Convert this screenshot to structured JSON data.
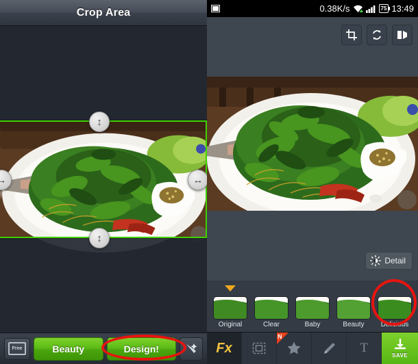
{
  "left": {
    "title": "Crop Area",
    "handles": [
      {
        "name": "crop-handle-top",
        "glyph": "↕"
      },
      {
        "name": "crop-handle-bottom",
        "glyph": "↕"
      },
      {
        "name": "crop-handle-left",
        "glyph": "↔"
      },
      {
        "name": "crop-handle-right",
        "glyph": "↔"
      }
    ],
    "toolbar": {
      "free_label": "Free",
      "beauty_label": "Beauty",
      "design_label": "Design!",
      "wand_icon": "magic-wand-icon"
    },
    "annotation": "red-ellipse-highlight-design-button",
    "crop_border_color": "#3fd200"
  },
  "right": {
    "statusbar": {
      "photo_icon": "photo-icon",
      "net_speed": "0.38K/s",
      "wifi_icon": "wifi-icon",
      "signal_icon": "signal-bars-icon",
      "battery_level": "75",
      "time": "13:49"
    },
    "top_tools": [
      {
        "name": "crop-tool-icon",
        "label": "crop"
      },
      {
        "name": "rotate-tool-icon",
        "label": "rotate"
      },
      {
        "name": "mirror-tool-icon",
        "label": "mirror"
      }
    ],
    "detail_button": {
      "label": "Detail",
      "icon": "brightness-icon"
    },
    "filters": [
      {
        "label": "Original",
        "selected": true,
        "circled": false
      },
      {
        "label": "Clear",
        "selected": false,
        "circled": false
      },
      {
        "label": "Baby",
        "selected": false,
        "circled": false
      },
      {
        "label": "Beauty",
        "selected": false,
        "circled": false
      },
      {
        "label": "Delicious",
        "selected": false,
        "circled": true
      }
    ],
    "bottom_tabs": [
      {
        "name": "tab-fx",
        "label": "Fx",
        "active": true,
        "badge": ""
      },
      {
        "name": "tab-frame",
        "label": "",
        "active": false,
        "badge": ""
      },
      {
        "name": "tab-sticker",
        "label": "",
        "active": false,
        "badge": "N"
      },
      {
        "name": "tab-brush",
        "label": "",
        "active": false,
        "badge": ""
      },
      {
        "name": "tab-text",
        "label": "T",
        "active": false,
        "badge": ""
      }
    ],
    "save_button": {
      "label": "SAVE",
      "icon": "download-icon",
      "color": "#5cbb16"
    },
    "annotation": "red-ellipse-highlight-delicious-filter"
  }
}
